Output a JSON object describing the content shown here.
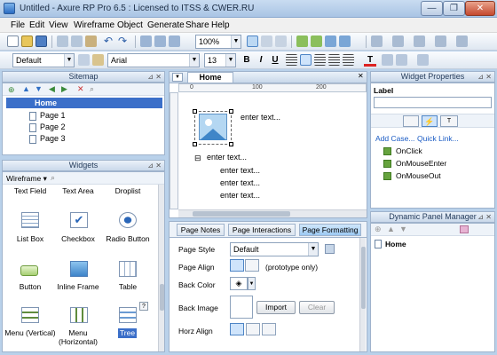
{
  "window": {
    "title": "Untitled - Axure RP Pro 6.5 : Licensed to ITSS & CWER.RU",
    "min": "—",
    "max": "❐",
    "close": "✕"
  },
  "menu": [
    "File",
    "Edit",
    "View",
    "Wireframe",
    "Object",
    "Generate",
    "Share",
    "Help"
  ],
  "toolbar": {
    "zoom": "100%",
    "style": "Default",
    "font": "Arial",
    "size": "13",
    "bold": "B",
    "italic": "I",
    "underline": "U",
    "textcolor": "T"
  },
  "sitemap": {
    "title": "Sitemap",
    "home": "Home",
    "pages": [
      "Page 1",
      "Page 2",
      "Page 3"
    ]
  },
  "widgets": {
    "title": "Widgets",
    "library": "Wireframe",
    "top_row": [
      "Text Field",
      "Text Area",
      "Droplist"
    ],
    "items": [
      [
        "List Box",
        "Checkbox",
        "Radio Button"
      ],
      [
        "Button",
        "Inline Frame",
        "Table"
      ],
      [
        "Menu (Vertical)",
        "Menu (Horizontal)",
        "Tree"
      ]
    ],
    "help": "?"
  },
  "canvas": {
    "tab": "Home",
    "ruler_marks": [
      "0",
      "100",
      "200"
    ],
    "image_text": "enter text...",
    "tree_root": "enter text...",
    "tree_children": [
      "enter text...",
      "enter text...",
      "enter text..."
    ],
    "collapse": "⊟"
  },
  "bottom_tabs": [
    "Page Notes",
    "Page Interactions",
    "Page Formatting"
  ],
  "formatting": {
    "page_style_label": "Page Style",
    "page_style_value": "Default",
    "page_align_label": "Page Align",
    "page_align_note": "(prototype only)",
    "back_color_label": "Back Color",
    "back_image_label": "Back Image",
    "import": "Import",
    "clear": "Clear",
    "horz_align_label": "Horz Align"
  },
  "widget_properties": {
    "title": "Widget Properties",
    "label": "Label",
    "add_case": "Add Case...",
    "quick_link": "Quick Link...",
    "events": [
      "OnClick",
      "OnMouseEnter",
      "OnMouseOut"
    ]
  },
  "dynamic_panel": {
    "title": "Dynamic Panel Manager",
    "home": "Home"
  }
}
